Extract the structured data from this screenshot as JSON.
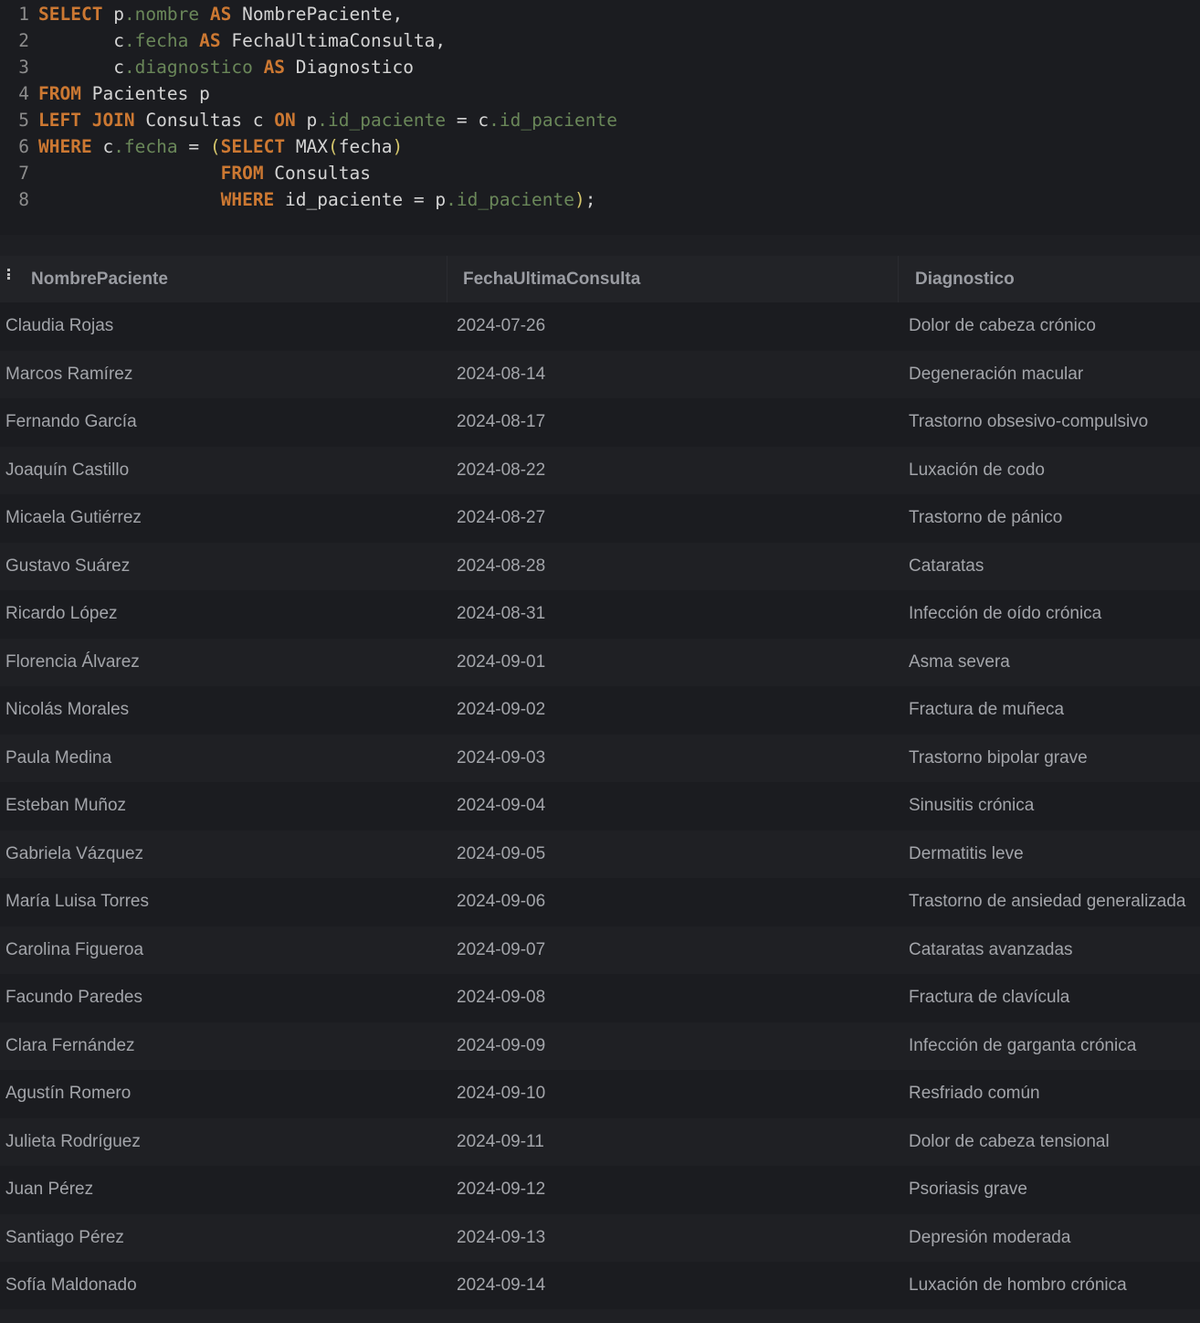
{
  "editor": {
    "lines": [
      {
        "n": "1",
        "indent": "",
        "tokens": [
          [
            "kw",
            "SELECT"
          ],
          [
            "id",
            " p"
          ],
          [
            "fld",
            ".nombre"
          ],
          [
            "kw",
            " AS"
          ],
          [
            "id",
            " NombrePaciente,"
          ]
        ]
      },
      {
        "n": "2",
        "indent": "       ",
        "tokens": [
          [
            "id",
            "c"
          ],
          [
            "fld",
            ".fecha"
          ],
          [
            "kw",
            " AS"
          ],
          [
            "id",
            " FechaUltimaConsulta,"
          ]
        ]
      },
      {
        "n": "3",
        "indent": "       ",
        "tokens": [
          [
            "id",
            "c"
          ],
          [
            "fld",
            ".diagnostico"
          ],
          [
            "kw",
            " AS"
          ],
          [
            "id",
            " Diagnostico"
          ]
        ]
      },
      {
        "n": "4",
        "indent": "",
        "tokens": [
          [
            "kw",
            "FROM"
          ],
          [
            "id",
            " Pacientes p"
          ]
        ]
      },
      {
        "n": "5",
        "indent": "",
        "tokens": [
          [
            "kw",
            "LEFT JOIN"
          ],
          [
            "id",
            " Consultas c "
          ],
          [
            "kw",
            "ON"
          ],
          [
            "id",
            " p"
          ],
          [
            "fld",
            ".id_paciente"
          ],
          [
            "id",
            " = c"
          ],
          [
            "fld",
            ".id_paciente"
          ]
        ]
      },
      {
        "n": "6",
        "indent": "",
        "tokens": [
          [
            "kw",
            "WHERE"
          ],
          [
            "id",
            " c"
          ],
          [
            "fld",
            ".fecha"
          ],
          [
            "id",
            " = "
          ],
          [
            "pn",
            "("
          ],
          [
            "kw",
            "SELECT"
          ],
          [
            "id",
            " MAX"
          ],
          [
            "pn",
            "("
          ],
          [
            "id",
            "fecha"
          ],
          [
            "pn",
            ")"
          ]
        ]
      },
      {
        "n": "7",
        "indent": "                 ",
        "tokens": [
          [
            "kw",
            "FROM"
          ],
          [
            "id",
            " Consultas"
          ]
        ]
      },
      {
        "n": "8",
        "indent": "                 ",
        "tokens": [
          [
            "kw",
            "WHERE"
          ],
          [
            "id",
            " id_paciente = p"
          ],
          [
            "fld",
            ".id_paciente"
          ],
          [
            "pn",
            ")"
          ],
          [
            "id",
            ";"
          ]
        ]
      }
    ]
  },
  "table": {
    "columns": [
      "NombrePaciente",
      "FechaUltimaConsulta",
      "Diagnostico"
    ],
    "rows": [
      [
        "Claudia Rojas",
        "2024-07-26",
        "Dolor de cabeza crónico"
      ],
      [
        "Marcos Ramírez",
        "2024-08-14",
        "Degeneración macular"
      ],
      [
        "Fernando García",
        "2024-08-17",
        "Trastorno obsesivo-compulsivo"
      ],
      [
        "Joaquín Castillo",
        "2024-08-22",
        "Luxación de codo"
      ],
      [
        "Micaela Gutiérrez",
        "2024-08-27",
        "Trastorno de pánico"
      ],
      [
        "Gustavo Suárez",
        "2024-08-28",
        "Cataratas"
      ],
      [
        "Ricardo López",
        "2024-08-31",
        "Infección de oído crónica"
      ],
      [
        "Florencia Álvarez",
        "2024-09-01",
        "Asma severa"
      ],
      [
        "Nicolás Morales",
        "2024-09-02",
        "Fractura de muñeca"
      ],
      [
        "Paula Medina",
        "2024-09-03",
        "Trastorno bipolar grave"
      ],
      [
        "Esteban Muñoz",
        "2024-09-04",
        "Sinusitis crónica"
      ],
      [
        "Gabriela Vázquez",
        "2024-09-05",
        "Dermatitis leve"
      ],
      [
        "María Luisa Torres",
        "2024-09-06",
        "Trastorno de ansiedad generalizada"
      ],
      [
        "Carolina Figueroa",
        "2024-09-07",
        "Cataratas avanzadas"
      ],
      [
        "Facundo Paredes",
        "2024-09-08",
        "Fractura de clavícula"
      ],
      [
        "Clara Fernández",
        "2024-09-09",
        "Infección de garganta crónica"
      ],
      [
        "Agustín Romero",
        "2024-09-10",
        "Resfriado común"
      ],
      [
        "Julieta Rodríguez",
        "2024-09-11",
        "Dolor de cabeza tensional"
      ],
      [
        "Juan Pérez",
        "2024-09-12",
        "Psoriasis grave"
      ],
      [
        "Santiago Pérez",
        "2024-09-13",
        "Depresión moderada"
      ],
      [
        "Sofía Maldonado",
        "2024-09-14",
        "Luxación de hombro crónica"
      ]
    ]
  }
}
